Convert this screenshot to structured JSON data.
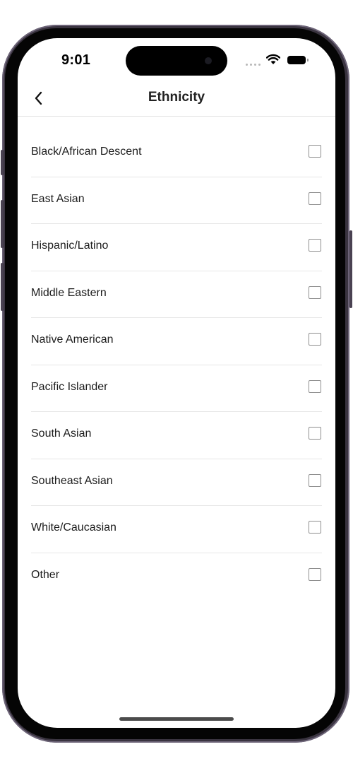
{
  "status_bar": {
    "time": "9:01"
  },
  "header": {
    "back_icon": "chevron-left-icon",
    "title": "Ethnicity"
  },
  "options": [
    {
      "label": "Black/African Descent",
      "checked": false
    },
    {
      "label": "East Asian",
      "checked": false
    },
    {
      "label": "Hispanic/Latino",
      "checked": false
    },
    {
      "label": "Middle Eastern",
      "checked": false
    },
    {
      "label": "Native American",
      "checked": false
    },
    {
      "label": "Pacific Islander",
      "checked": false
    },
    {
      "label": "South Asian",
      "checked": false
    },
    {
      "label": "Southeast Asian",
      "checked": false
    },
    {
      "label": "White/Caucasian",
      "checked": false
    },
    {
      "label": "Other",
      "checked": false
    }
  ],
  "colors": {
    "frame": "#3a3440",
    "text": "#1c1c1c",
    "divider": "#e6e6e6",
    "checkbox_border": "#8e8e8e"
  }
}
